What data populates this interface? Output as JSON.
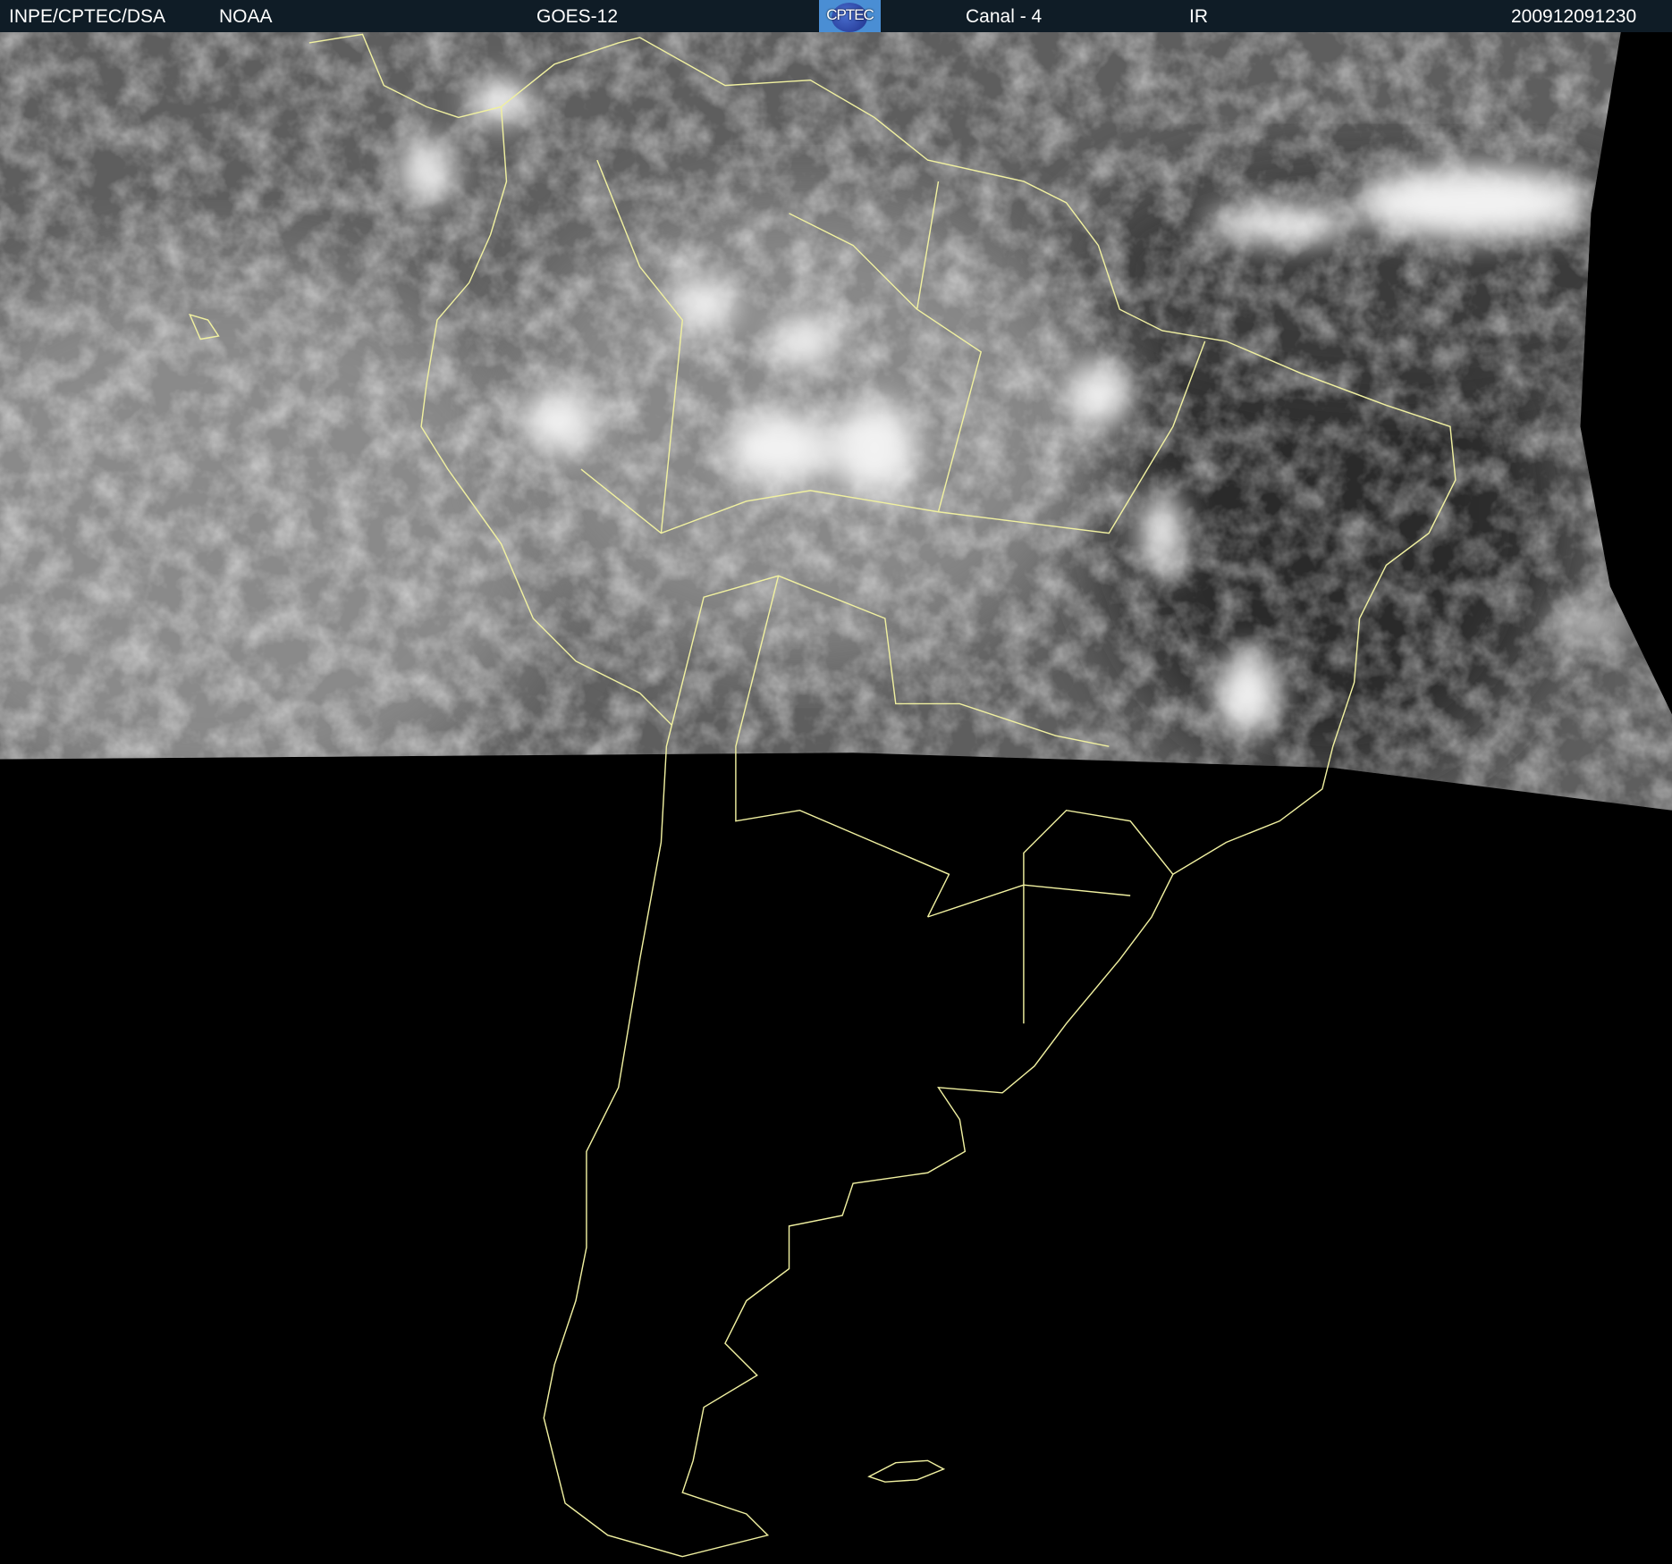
{
  "header": {
    "source": "INPE/CPTEC/DSA",
    "agency": "NOAA",
    "satellite": "GOES-12",
    "logo_text": "CPTEC",
    "channel": "Canal - 4",
    "band": "IR",
    "timestamp": "200912091230"
  },
  "colors": {
    "header_bg": "#0f1c26",
    "coastline": "#f0f0a0",
    "logo_bg": "#4a8ed4"
  }
}
